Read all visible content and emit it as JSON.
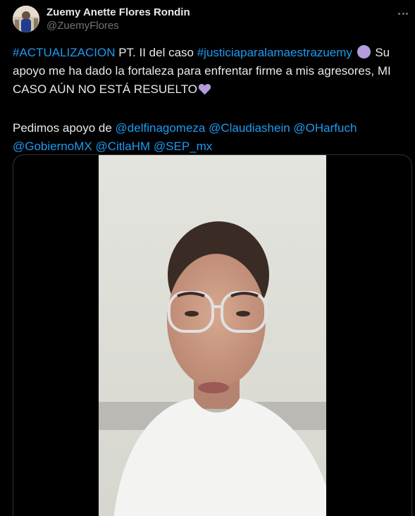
{
  "author": {
    "display_name": "Zuemy Anette Flores Rondin",
    "handle": "@ZuemyFlores"
  },
  "tweet": {
    "hashtag_update": "#ACTUALIZACION",
    "text_1": " PT. II del caso ",
    "hashtag_justice": "#justiciaparalamaestrazuemy",
    "emoji_1": "purple-circle-emoji",
    "text_2": " Su apoyo me ha dado la fortaleza para enfrentar firme a mis agresores, MI CASO AÚN NO ESTÁ RESUELTO",
    "emoji_2": "purple-heart-emoji",
    "text_3": "Pedimos apoyo de ",
    "mentions": [
      "@delfinagomeza",
      "@Claudiashein",
      "@OHarfuch",
      "@GobiernoMX",
      "@CitlaHM",
      "@SEP_mx"
    ]
  },
  "colors": {
    "background": "#000000",
    "text": "#e7e9ea",
    "secondary_text": "#71767b",
    "link": "#1d9bf0",
    "border": "#2f3336",
    "emoji_purple": "#b39ddb"
  },
  "icons": {
    "more": "more-options-icon"
  }
}
